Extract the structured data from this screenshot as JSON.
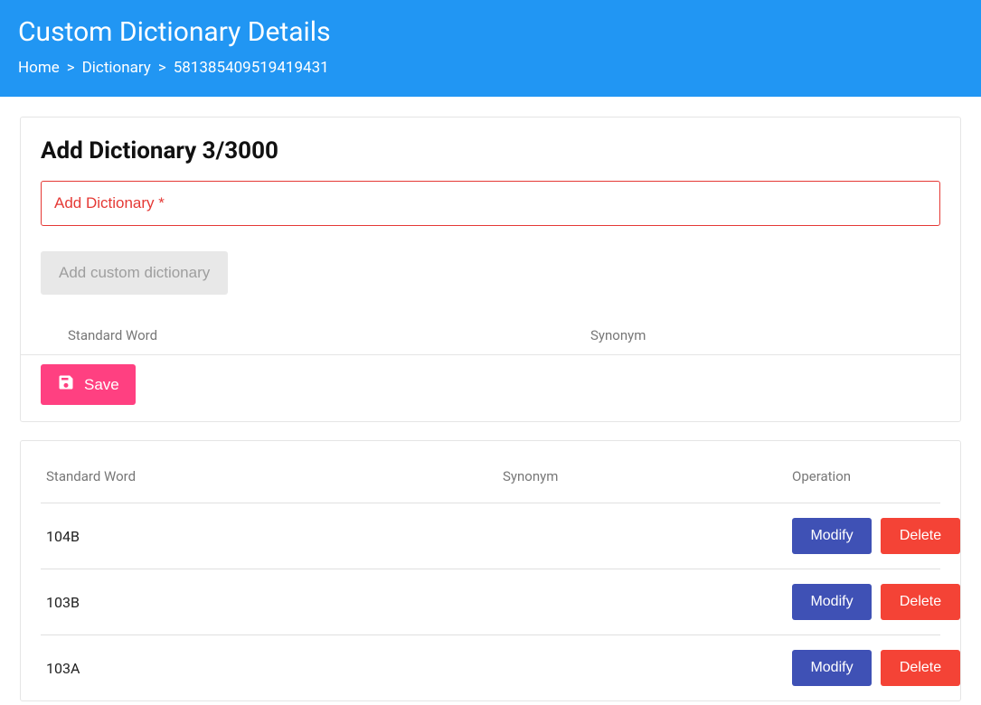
{
  "header": {
    "title": "Custom Dictionary Details",
    "breadcrumb": {
      "home": "Home",
      "dictionary": "Dictionary",
      "id": "581385409519419431"
    }
  },
  "add_section": {
    "title": "Add Dictionary 3/3000",
    "input_placeholder": "Add Dictionary *",
    "add_button": "Add custom dictionary",
    "col_standard": "Standard Word",
    "col_synonym": "Synonym",
    "save_button": "Save"
  },
  "list_section": {
    "col_standard": "Standard Word",
    "col_synonym": "Synonym",
    "col_operation": "Operation",
    "modify_label": "Modify",
    "delete_label": "Delete",
    "rows": [
      {
        "standard": "104B",
        "synonym": ""
      },
      {
        "standard": "103B",
        "synonym": ""
      },
      {
        "standard": "103A",
        "synonym": ""
      }
    ]
  }
}
